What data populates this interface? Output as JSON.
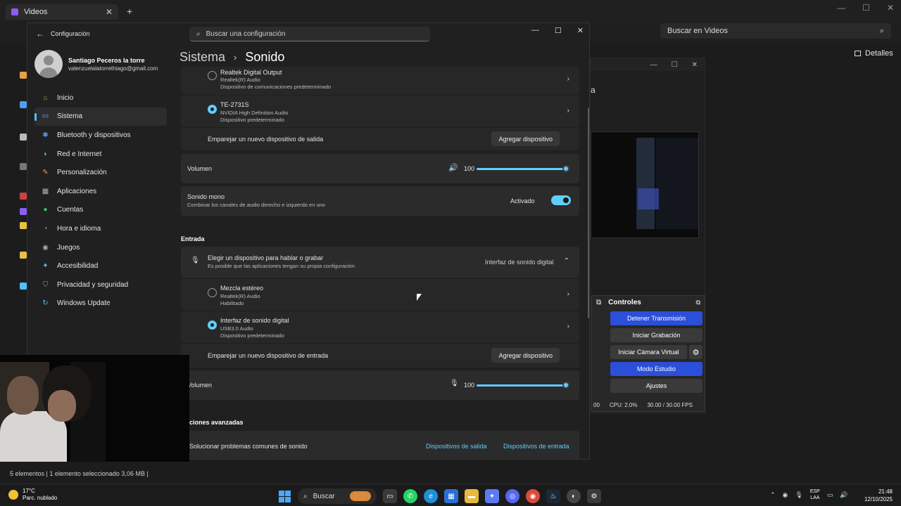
{
  "explorer": {
    "tab_title": "Videos",
    "search_placeholder": "Buscar en Videos",
    "details_label": "Detalles",
    "status": "5 elementos  |  1 elemento seleccionado  3,06 MB  |"
  },
  "obs": {
    "partial_title": "a",
    "dock_title": "Controles",
    "buttons": [
      {
        "label": "Detener Transmisión",
        "style": "blue"
      },
      {
        "label": "Iniciar Grabación",
        "style": "gray"
      },
      {
        "label": "Iniciar Cámara Virtual",
        "style": "gray"
      },
      {
        "label": "Modo Estudio",
        "style": "blue"
      },
      {
        "label": "Ajustes",
        "style": "gray"
      }
    ],
    "stats": {
      "time": "00",
      "cpu": "CPU: 2.0%",
      "fps": "30.00 / 30.00 FPS"
    }
  },
  "settings": {
    "app_title": "Configuración",
    "search_placeholder": "Buscar una configuración",
    "profile": {
      "name": "Santiago Peceros la torre",
      "email": "valenzuelalatorrethiago@gmail.com"
    },
    "nav": [
      {
        "label": "Inicio",
        "icon": "home-icon",
        "color": "#e8a040",
        "glyph": "⌂"
      },
      {
        "label": "Sistema",
        "icon": "system-icon",
        "color": "#4cc2ff",
        "glyph": "▭",
        "active": true
      },
      {
        "label": "Bluetooth y dispositivos",
        "icon": "bluetooth-icon",
        "color": "#4a9eff",
        "glyph": "✱"
      },
      {
        "label": "Red e Internet",
        "icon": "wifi-icon",
        "color": "#4cc2ff",
        "glyph": "◗"
      },
      {
        "label": "Personalización",
        "icon": "brush-icon",
        "color": "#e0a060",
        "glyph": "✎"
      },
      {
        "label": "Aplicaciones",
        "icon": "apps-icon",
        "color": "#b0b0c8",
        "glyph": "▦"
      },
      {
        "label": "Cuentas",
        "icon": "account-icon",
        "color": "#3ec46d",
        "glyph": "●"
      },
      {
        "label": "Hora e idioma",
        "icon": "clock-globe-icon",
        "color": "#4cc2ff",
        "glyph": "◔"
      },
      {
        "label": "Juegos",
        "icon": "gamepad-icon",
        "color": "#aaaaaa",
        "glyph": "◉"
      },
      {
        "label": "Accesibilidad",
        "icon": "accessibility-icon",
        "color": "#4cc2ff",
        "glyph": "✦"
      },
      {
        "label": "Privacidad y seguridad",
        "icon": "shield-icon",
        "color": "#9a9a9a",
        "glyph": "⛉"
      },
      {
        "label": "Windows Update",
        "icon": "update-icon",
        "color": "#4cc2ff",
        "glyph": "↻"
      }
    ],
    "breadcrumb": {
      "parent": "Sistema",
      "current": "Sonido"
    },
    "output": {
      "dev1": {
        "name": "Realtek Digital Output",
        "sub1": "Realtek(R) Audio",
        "sub2": "Dispositivo de comunicaciones predeterminado"
      },
      "dev2": {
        "name": "TE-2731S",
        "sub1": "NVIDIA High Definition Audio",
        "sub2": "Dispositivo predeterminado"
      },
      "pair_label": "Emparejar un nuevo dispositivo de salida",
      "add_button": "Agregar dispositivo",
      "volume_label": "Volumen",
      "volume_value": "100",
      "mono_label": "Sonido mono",
      "mono_desc": "Combinar los canales de audio derecho e izquierdo en uno",
      "mono_state": "Activado"
    },
    "input": {
      "section": "Entrada",
      "choose_label": "Elegir un dispositivo para hablar o grabar",
      "choose_desc": "Es posible que las aplicaciones tengan su propia configuración",
      "choose_value": "Interfaz de sonido digital",
      "dev1": {
        "name": "Mezcla estéreo",
        "sub1": "Realtek(R) Audio",
        "sub2": "Habilitado"
      },
      "dev2": {
        "name": "Interfaz de sonido digital",
        "sub1": "USB3.0 Audio",
        "sub2": "Dispositivo predeterminado"
      },
      "pair_label": "Emparejar un nuevo dispositivo de entrada",
      "add_button": "Agregar dispositivo",
      "volume_label": "Volumen",
      "volume_value": "100"
    },
    "advanced": {
      "section": "ciones avanzadas",
      "troubleshoot": "Solucionar problemas comunes de sonido",
      "link_out": "Dispositivos de salida",
      "link_in": "Dispositivos de entrada"
    }
  },
  "taskbar": {
    "weather_temp": "17°C",
    "weather_desc": "Parc. nublado",
    "search_label": "Buscar",
    "lang_top": "ESP",
    "lang_bottom": "LAA",
    "time": "21:48",
    "date": "12/10/2025"
  }
}
